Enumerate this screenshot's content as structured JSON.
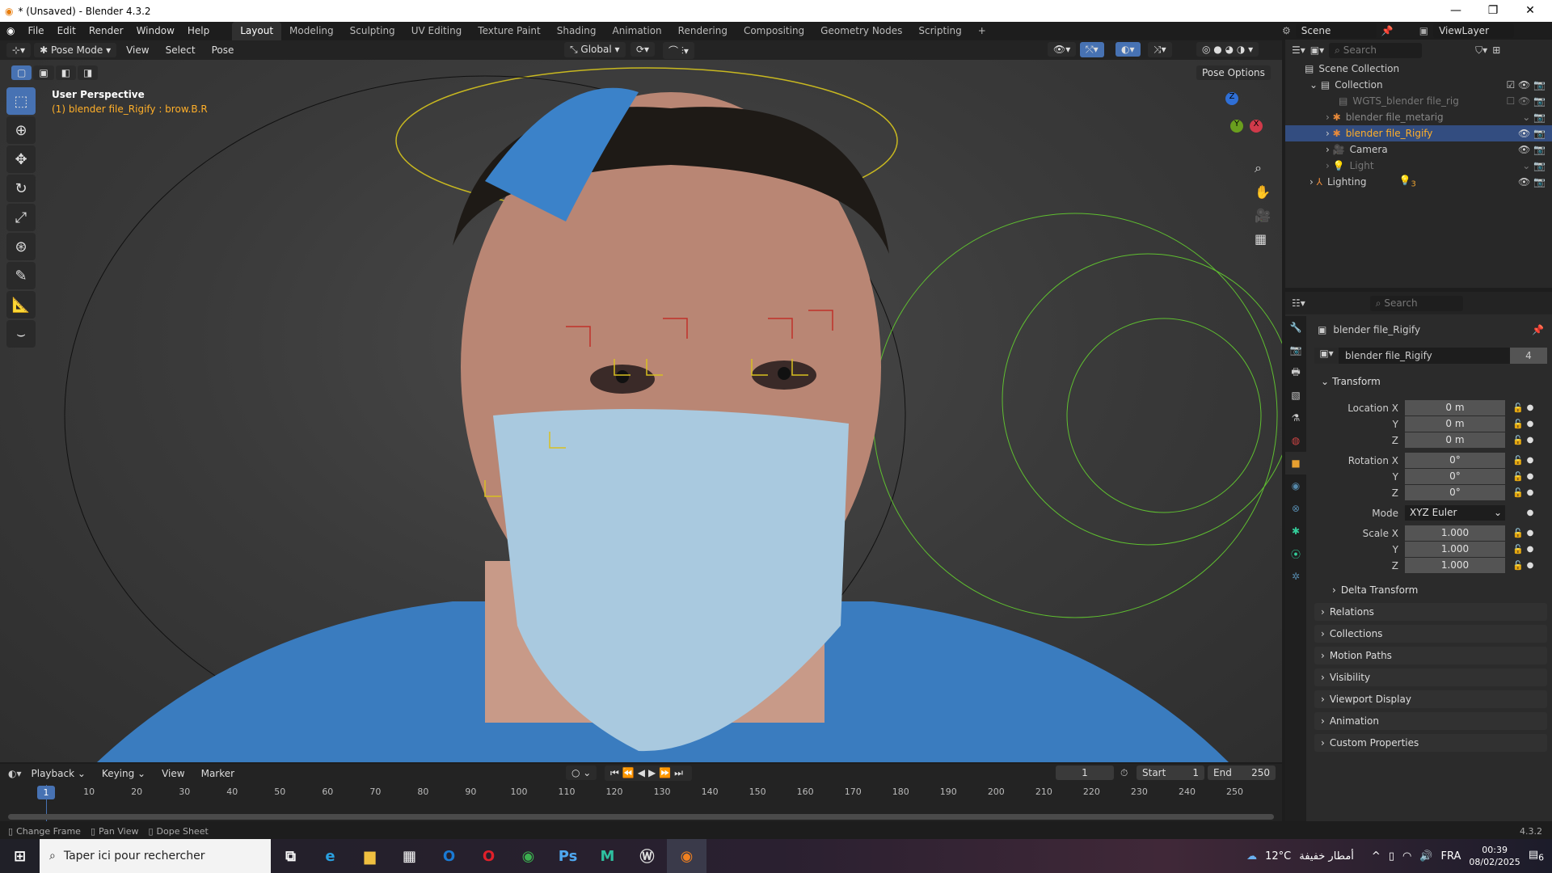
{
  "window": {
    "title": "* (Unsaved) - Blender 4.3.2",
    "minimize": "—",
    "maximize": "❐",
    "close": "✕"
  },
  "menu": [
    "File",
    "Edit",
    "Render",
    "Window",
    "Help"
  ],
  "workspaces": [
    "Layout",
    "Modeling",
    "Sculpting",
    "UV Editing",
    "Texture Paint",
    "Shading",
    "Animation",
    "Rendering",
    "Compositing",
    "Geometry Nodes",
    "Scripting",
    "+"
  ],
  "viewport_header": {
    "mode": "Pose Mode",
    "menus": [
      "View",
      "Select",
      "Pose"
    ],
    "orientation": "Global",
    "pose_options": "Pose Options"
  },
  "viewport": {
    "view_name": "User Perspective",
    "active": "(1) blender file_Rigify : brow.B.R",
    "gizmo": {
      "z": "Z",
      "y": "Y",
      "x": "X"
    }
  },
  "scene": {
    "scene": "Scene",
    "view_layer": "ViewLayer"
  },
  "outliner": {
    "search_placeholder": "Search",
    "items": [
      {
        "name": "Scene Collection",
        "indent": 0
      },
      {
        "name": "Collection",
        "indent": 1
      },
      {
        "name": "WGTS_blender file_rig",
        "indent": 2,
        "dim": true
      },
      {
        "name": "blender file_metarig",
        "indent": 2,
        "dim": true
      },
      {
        "name": "blender file_Rigify",
        "indent": 2,
        "selected": true
      },
      {
        "name": "Camera",
        "indent": 2
      },
      {
        "name": "Light",
        "indent": 2,
        "dim": true
      },
      {
        "name": "Lighting",
        "indent": 1
      }
    ],
    "lighting_count": "3"
  },
  "properties": {
    "search_placeholder": "Search",
    "object_name": "blender file_Rigify",
    "data_name": "blender file_Rigify",
    "users": "4",
    "transform_label": "Transform",
    "rows": [
      {
        "label": "Location X",
        "value": "0 m"
      },
      {
        "label": "Y",
        "value": "0 m"
      },
      {
        "label": "Z",
        "value": "0 m"
      },
      {
        "label": "Rotation X",
        "value": "0°"
      },
      {
        "label": "Y",
        "value": "0°"
      },
      {
        "label": "Z",
        "value": "0°"
      },
      {
        "label": "Mode",
        "value": "XYZ Euler"
      },
      {
        "label": "Scale X",
        "value": "1.000"
      },
      {
        "label": "Y",
        "value": "1.000"
      },
      {
        "label": "Z",
        "value": "1.000"
      }
    ],
    "delta": "Delta Transform",
    "panels": [
      "Relations",
      "Collections",
      "Motion Paths",
      "Visibility",
      "Viewport Display",
      "Animation",
      "Custom Properties"
    ]
  },
  "timeline": {
    "menus": [
      "Playback",
      "Keying",
      "View",
      "Marker"
    ],
    "current_frame": "1",
    "start_label": "Start",
    "start": "1",
    "end_label": "End",
    "end": "250",
    "ticks": [
      "10",
      "20",
      "30",
      "40",
      "50",
      "60",
      "70",
      "80",
      "90",
      "100",
      "110",
      "120",
      "130",
      "140",
      "150",
      "160",
      "170",
      "180",
      "190",
      "200",
      "210",
      "220",
      "230",
      "240",
      "250"
    ],
    "playhead": "1"
  },
  "status": {
    "items": [
      "Change Frame",
      "Pan View",
      "Dope Sheet"
    ],
    "version": "4.3.2"
  },
  "taskbar": {
    "search_placeholder": "Taper ici pour rechercher",
    "weather": "12°C",
    "weather_text": "أمطار خفيفة",
    "lang": "FRA",
    "time": "00:39",
    "date": "08/02/2025",
    "notifications": "6"
  },
  "colors": {
    "accent": "#4772b3",
    "selected_row": "#334d80",
    "active_text": "#ffaf29"
  }
}
